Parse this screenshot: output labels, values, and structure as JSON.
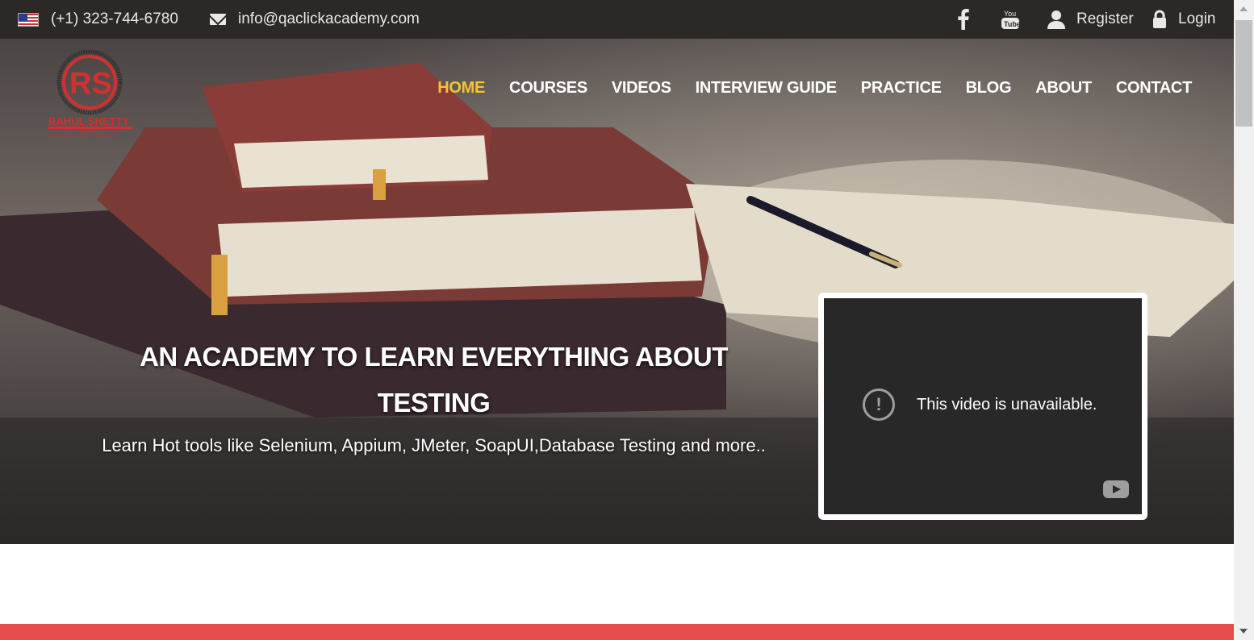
{
  "topbar": {
    "phone": "(+1) 323-744-6780",
    "email": "info@qaclickacademy.com",
    "register": "Register",
    "login": "Login",
    "icons": [
      "us-flag-icon",
      "envelope-icon",
      "facebook-icon",
      "youtube-icon",
      "user-icon",
      "lock-icon"
    ]
  },
  "logo": {
    "monogram": "RS",
    "name": "RAHUL SHETTY",
    "sub": "ACADEMY",
    "tagline": "BECOME TEST EXPERT"
  },
  "nav": {
    "items": [
      "HOME",
      "COURSES",
      "VIDEOS",
      "INTERVIEW GUIDE",
      "PRACTICE",
      "BLOG",
      "ABOUT",
      "CONTACT"
    ],
    "active": "HOME",
    "active_color": "#f4c430"
  },
  "hero": {
    "title_line1": "AN ACADEMY TO LEARN EVERYTHING ABOUT",
    "title_line2": "TESTING",
    "subtitle": "Learn Hot tools like Selenium, Appium, JMeter, SoapUI,Database Testing and more.."
  },
  "video": {
    "message": "This video is unavailable."
  },
  "colors": {
    "topbar": "#2b2826",
    "accent_red": "#e74c4c",
    "logo_red": "#d32f2f"
  }
}
